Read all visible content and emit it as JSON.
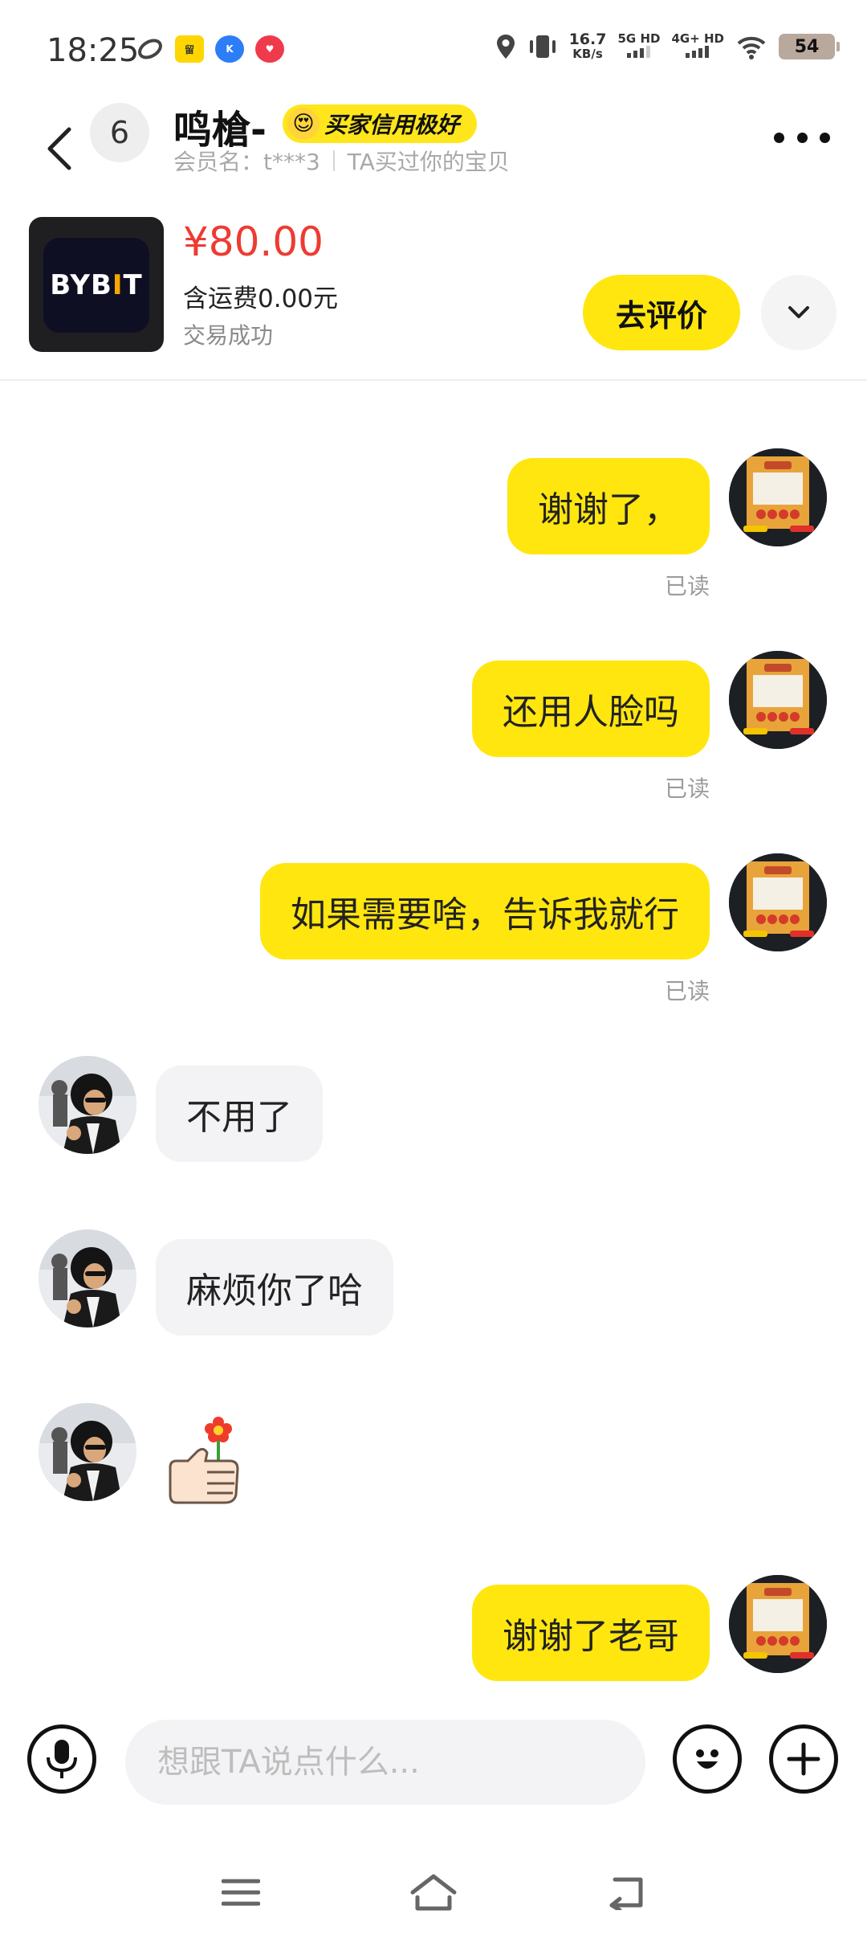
{
  "status_bar": {
    "time": "18:25",
    "app_icons": [
      "qzone-icon",
      "app-yellow-icon",
      "app-blue-k-icon",
      "app-red-icon"
    ],
    "speed_value": "16.7",
    "speed_unit": "KB/s",
    "net1_label": "5G HD",
    "net2_label": "4G+ HD",
    "battery": "54"
  },
  "header": {
    "unread_count": "6",
    "contact_name": "鸣槍-",
    "credit_badge": "买家信用极好",
    "member_label": "会员名：t***3",
    "purchase_note": "TA买过你的宝贝"
  },
  "product": {
    "thumb_text_prefix": "BYB",
    "thumb_text_accent": "I",
    "thumb_text_suffix": "T",
    "price": "¥80.00",
    "shipping": "含运费0.00元",
    "status": "交易成功",
    "review_button": "去评价"
  },
  "messages": [
    {
      "side": "me",
      "text": "谢谢了，",
      "read": "已读"
    },
    {
      "side": "me",
      "text": "还用人脸吗",
      "read": "已读"
    },
    {
      "side": "me",
      "text": "如果需要啥，告诉我就行",
      "read": "已读"
    },
    {
      "side": "them",
      "text": "不用了"
    },
    {
      "side": "them",
      "text": "麻烦你了哈"
    },
    {
      "side": "them",
      "sticker": "thumbs-up-flower-sticker"
    },
    {
      "side": "me",
      "text": "谢谢了老哥"
    }
  ],
  "input": {
    "placeholder": "想跟TA说点什么..."
  },
  "colors": {
    "accent_yellow": "#ffe60f",
    "price_red": "#ee3b32",
    "bubble_gray": "#f3f3f5"
  }
}
